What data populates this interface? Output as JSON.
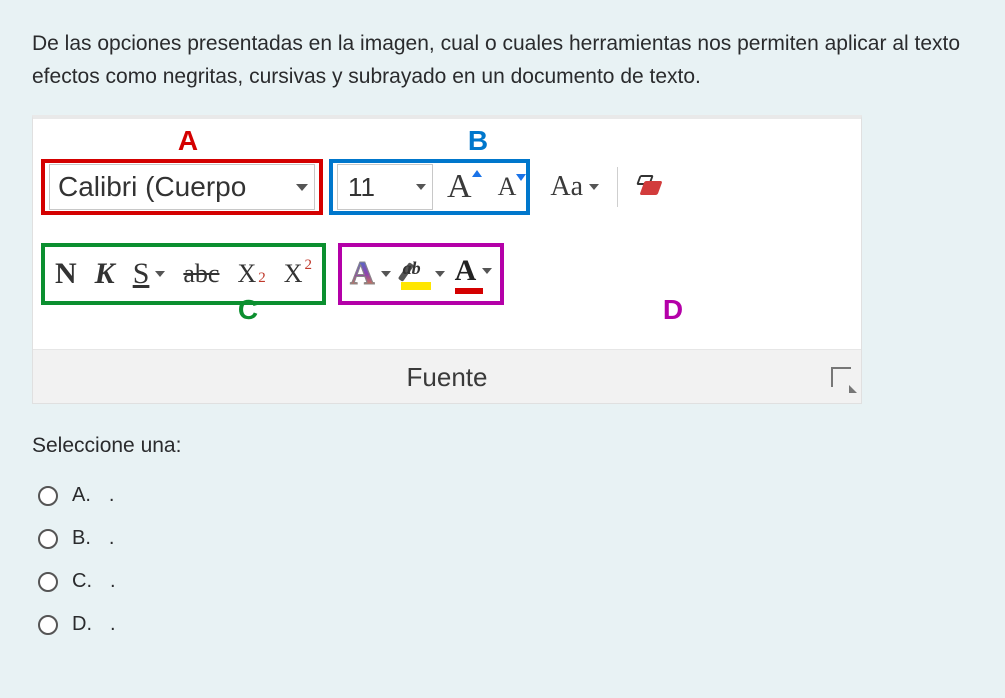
{
  "question": {
    "text": "De las opciones presentadas en la imagen, cual o cuales herramientas nos permiten aplicar al texto efectos como negritas, cursivas y subrayado en un documento de texto."
  },
  "ribbon": {
    "labels": {
      "a": "A",
      "b": "B",
      "c": "C",
      "d": "D"
    },
    "font_name": "Calibri (Cuerpo",
    "font_size": "11",
    "grow": "A",
    "shrink": "A",
    "change_case": "Aa",
    "row2": {
      "bold": "N",
      "italic": "K",
      "underline": "S",
      "strike": "abc",
      "sub_base": "X",
      "sub_small": "2",
      "sup_base": "X",
      "sup_small": "2",
      "effect": "A",
      "fontcolor": "A"
    },
    "section": "Fuente"
  },
  "prompt": "Seleccione una:",
  "options": [
    {
      "label": "A.",
      "text": "."
    },
    {
      "label": "B.",
      "text": "."
    },
    {
      "label": "C.",
      "text": "."
    },
    {
      "label": "D.",
      "text": "."
    }
  ]
}
